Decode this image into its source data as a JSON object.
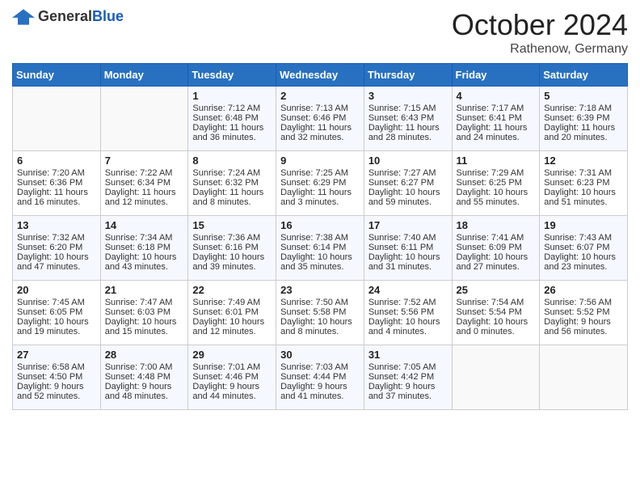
{
  "header": {
    "logo_general": "General",
    "logo_blue": "Blue",
    "month": "October 2024",
    "location": "Rathenow, Germany"
  },
  "days_of_week": [
    "Sunday",
    "Monday",
    "Tuesday",
    "Wednesday",
    "Thursday",
    "Friday",
    "Saturday"
  ],
  "weeks": [
    [
      {
        "day": "",
        "sunrise": "",
        "sunset": "",
        "daylight": ""
      },
      {
        "day": "",
        "sunrise": "",
        "sunset": "",
        "daylight": ""
      },
      {
        "day": "1",
        "sunrise": "Sunrise: 7:12 AM",
        "sunset": "Sunset: 6:48 PM",
        "daylight": "Daylight: 11 hours and 36 minutes."
      },
      {
        "day": "2",
        "sunrise": "Sunrise: 7:13 AM",
        "sunset": "Sunset: 6:46 PM",
        "daylight": "Daylight: 11 hours and 32 minutes."
      },
      {
        "day": "3",
        "sunrise": "Sunrise: 7:15 AM",
        "sunset": "Sunset: 6:43 PM",
        "daylight": "Daylight: 11 hours and 28 minutes."
      },
      {
        "day": "4",
        "sunrise": "Sunrise: 7:17 AM",
        "sunset": "Sunset: 6:41 PM",
        "daylight": "Daylight: 11 hours and 24 minutes."
      },
      {
        "day": "5",
        "sunrise": "Sunrise: 7:18 AM",
        "sunset": "Sunset: 6:39 PM",
        "daylight": "Daylight: 11 hours and 20 minutes."
      }
    ],
    [
      {
        "day": "6",
        "sunrise": "Sunrise: 7:20 AM",
        "sunset": "Sunset: 6:36 PM",
        "daylight": "Daylight: 11 hours and 16 minutes."
      },
      {
        "day": "7",
        "sunrise": "Sunrise: 7:22 AM",
        "sunset": "Sunset: 6:34 PM",
        "daylight": "Daylight: 11 hours and 12 minutes."
      },
      {
        "day": "8",
        "sunrise": "Sunrise: 7:24 AM",
        "sunset": "Sunset: 6:32 PM",
        "daylight": "Daylight: 11 hours and 8 minutes."
      },
      {
        "day": "9",
        "sunrise": "Sunrise: 7:25 AM",
        "sunset": "Sunset: 6:29 PM",
        "daylight": "Daylight: 11 hours and 3 minutes."
      },
      {
        "day": "10",
        "sunrise": "Sunrise: 7:27 AM",
        "sunset": "Sunset: 6:27 PM",
        "daylight": "Daylight: 10 hours and 59 minutes."
      },
      {
        "day": "11",
        "sunrise": "Sunrise: 7:29 AM",
        "sunset": "Sunset: 6:25 PM",
        "daylight": "Daylight: 10 hours and 55 minutes."
      },
      {
        "day": "12",
        "sunrise": "Sunrise: 7:31 AM",
        "sunset": "Sunset: 6:23 PM",
        "daylight": "Daylight: 10 hours and 51 minutes."
      }
    ],
    [
      {
        "day": "13",
        "sunrise": "Sunrise: 7:32 AM",
        "sunset": "Sunset: 6:20 PM",
        "daylight": "Daylight: 10 hours and 47 minutes."
      },
      {
        "day": "14",
        "sunrise": "Sunrise: 7:34 AM",
        "sunset": "Sunset: 6:18 PM",
        "daylight": "Daylight: 10 hours and 43 minutes."
      },
      {
        "day": "15",
        "sunrise": "Sunrise: 7:36 AM",
        "sunset": "Sunset: 6:16 PM",
        "daylight": "Daylight: 10 hours and 39 minutes."
      },
      {
        "day": "16",
        "sunrise": "Sunrise: 7:38 AM",
        "sunset": "Sunset: 6:14 PM",
        "daylight": "Daylight: 10 hours and 35 minutes."
      },
      {
        "day": "17",
        "sunrise": "Sunrise: 7:40 AM",
        "sunset": "Sunset: 6:11 PM",
        "daylight": "Daylight: 10 hours and 31 minutes."
      },
      {
        "day": "18",
        "sunrise": "Sunrise: 7:41 AM",
        "sunset": "Sunset: 6:09 PM",
        "daylight": "Daylight: 10 hours and 27 minutes."
      },
      {
        "day": "19",
        "sunrise": "Sunrise: 7:43 AM",
        "sunset": "Sunset: 6:07 PM",
        "daylight": "Daylight: 10 hours and 23 minutes."
      }
    ],
    [
      {
        "day": "20",
        "sunrise": "Sunrise: 7:45 AM",
        "sunset": "Sunset: 6:05 PM",
        "daylight": "Daylight: 10 hours and 19 minutes."
      },
      {
        "day": "21",
        "sunrise": "Sunrise: 7:47 AM",
        "sunset": "Sunset: 6:03 PM",
        "daylight": "Daylight: 10 hours and 15 minutes."
      },
      {
        "day": "22",
        "sunrise": "Sunrise: 7:49 AM",
        "sunset": "Sunset: 6:01 PM",
        "daylight": "Daylight: 10 hours and 12 minutes."
      },
      {
        "day": "23",
        "sunrise": "Sunrise: 7:50 AM",
        "sunset": "Sunset: 5:58 PM",
        "daylight": "Daylight: 10 hours and 8 minutes."
      },
      {
        "day": "24",
        "sunrise": "Sunrise: 7:52 AM",
        "sunset": "Sunset: 5:56 PM",
        "daylight": "Daylight: 10 hours and 4 minutes."
      },
      {
        "day": "25",
        "sunrise": "Sunrise: 7:54 AM",
        "sunset": "Sunset: 5:54 PM",
        "daylight": "Daylight: 10 hours and 0 minutes."
      },
      {
        "day": "26",
        "sunrise": "Sunrise: 7:56 AM",
        "sunset": "Sunset: 5:52 PM",
        "daylight": "Daylight: 9 hours and 56 minutes."
      }
    ],
    [
      {
        "day": "27",
        "sunrise": "Sunrise: 6:58 AM",
        "sunset": "Sunset: 4:50 PM",
        "daylight": "Daylight: 9 hours and 52 minutes."
      },
      {
        "day": "28",
        "sunrise": "Sunrise: 7:00 AM",
        "sunset": "Sunset: 4:48 PM",
        "daylight": "Daylight: 9 hours and 48 minutes."
      },
      {
        "day": "29",
        "sunrise": "Sunrise: 7:01 AM",
        "sunset": "Sunset: 4:46 PM",
        "daylight": "Daylight: 9 hours and 44 minutes."
      },
      {
        "day": "30",
        "sunrise": "Sunrise: 7:03 AM",
        "sunset": "Sunset: 4:44 PM",
        "daylight": "Daylight: 9 hours and 41 minutes."
      },
      {
        "day": "31",
        "sunrise": "Sunrise: 7:05 AM",
        "sunset": "Sunset: 4:42 PM",
        "daylight": "Daylight: 9 hours and 37 minutes."
      },
      {
        "day": "",
        "sunrise": "",
        "sunset": "",
        "daylight": ""
      },
      {
        "day": "",
        "sunrise": "",
        "sunset": "",
        "daylight": ""
      }
    ]
  ]
}
